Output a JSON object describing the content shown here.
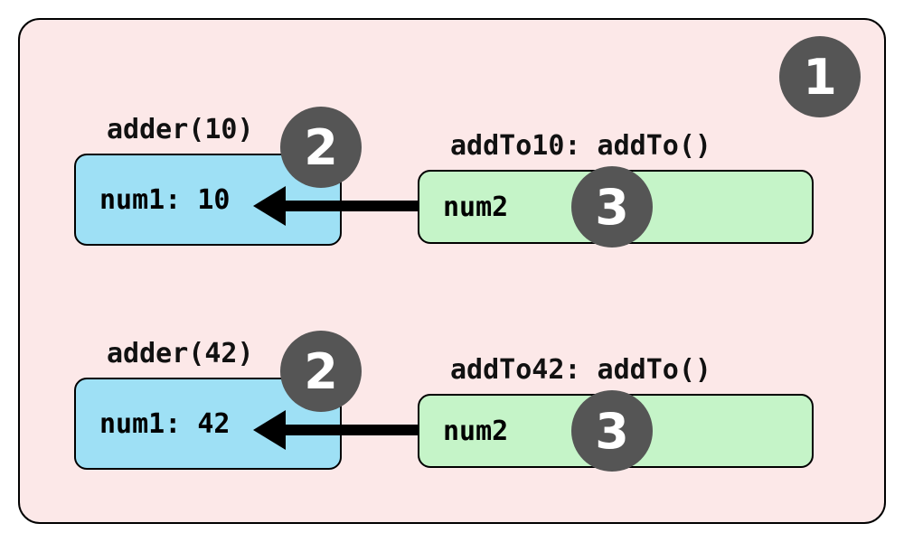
{
  "outer_badge": "1",
  "rows": [
    {
      "left_label": "adder(10)",
      "left_content": "num1: 10",
      "left_badge": "2",
      "right_label": "addTo10: addTo()",
      "right_content": "num2",
      "right_badge": "3"
    },
    {
      "left_label": "adder(42)",
      "left_content": "num1: 42",
      "left_badge": "2",
      "right_label": "addTo42: addTo()",
      "right_content": "num2",
      "right_badge": "3"
    }
  ]
}
